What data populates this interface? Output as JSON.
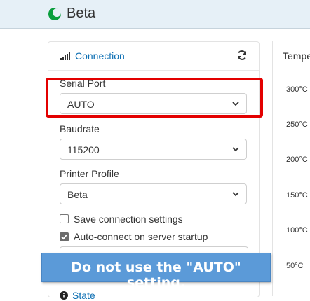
{
  "app": {
    "title": "Beta",
    "brand_color": "#0a9e3d"
  },
  "connection_panel": {
    "title": "Connection",
    "serial_port": {
      "label": "Serial Port",
      "value": "AUTO"
    },
    "baudrate": {
      "label": "Baudrate",
      "value": "115200"
    },
    "printer_profile": {
      "label": "Printer Profile",
      "value": "Beta"
    },
    "save_settings": {
      "label": "Save connection settings",
      "checked": false
    },
    "auto_connect": {
      "label": "Auto-connect on server startup",
      "checked": true
    }
  },
  "state_panel": {
    "title": "State"
  },
  "temperature_panel": {
    "title": "Tempe",
    "ticks": [
      "300°C",
      "250°C",
      "200°C",
      "150°C",
      "100°C",
      "50°C"
    ]
  },
  "callout": {
    "text": "Do not use the \"AUTO\" setting.",
    "color": "#5b9ad8"
  },
  "highlight": {
    "color": "#e30000"
  }
}
